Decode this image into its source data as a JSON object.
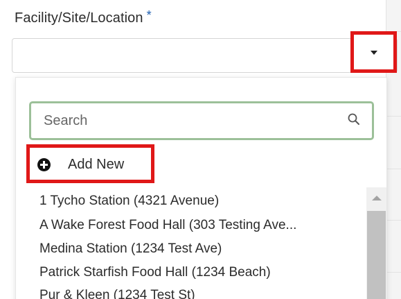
{
  "field": {
    "label": "Facility/Site/Location",
    "required_marker": "*",
    "selected_value": ""
  },
  "search": {
    "placeholder": "Search",
    "value": ""
  },
  "add_new": {
    "label": "Add New"
  },
  "options": [
    "1 Tycho Station (4321 Avenue)",
    "A Wake Forest Food Hall (303 Testing Ave...",
    "Medina Station (1234 Test Ave)",
    "Patrick Starfish Food Hall (1234 Beach)",
    "Pur & Kleen (1234 Test St)"
  ],
  "icons": {
    "caret": "chevron-down-icon",
    "search": "search-icon",
    "add": "plus-circle-icon",
    "scroll_up": "scroll-up-icon"
  },
  "colors": {
    "highlight_border": "#e01818",
    "search_focus_border": "#9cc099",
    "required_star": "#1f5fb0"
  }
}
